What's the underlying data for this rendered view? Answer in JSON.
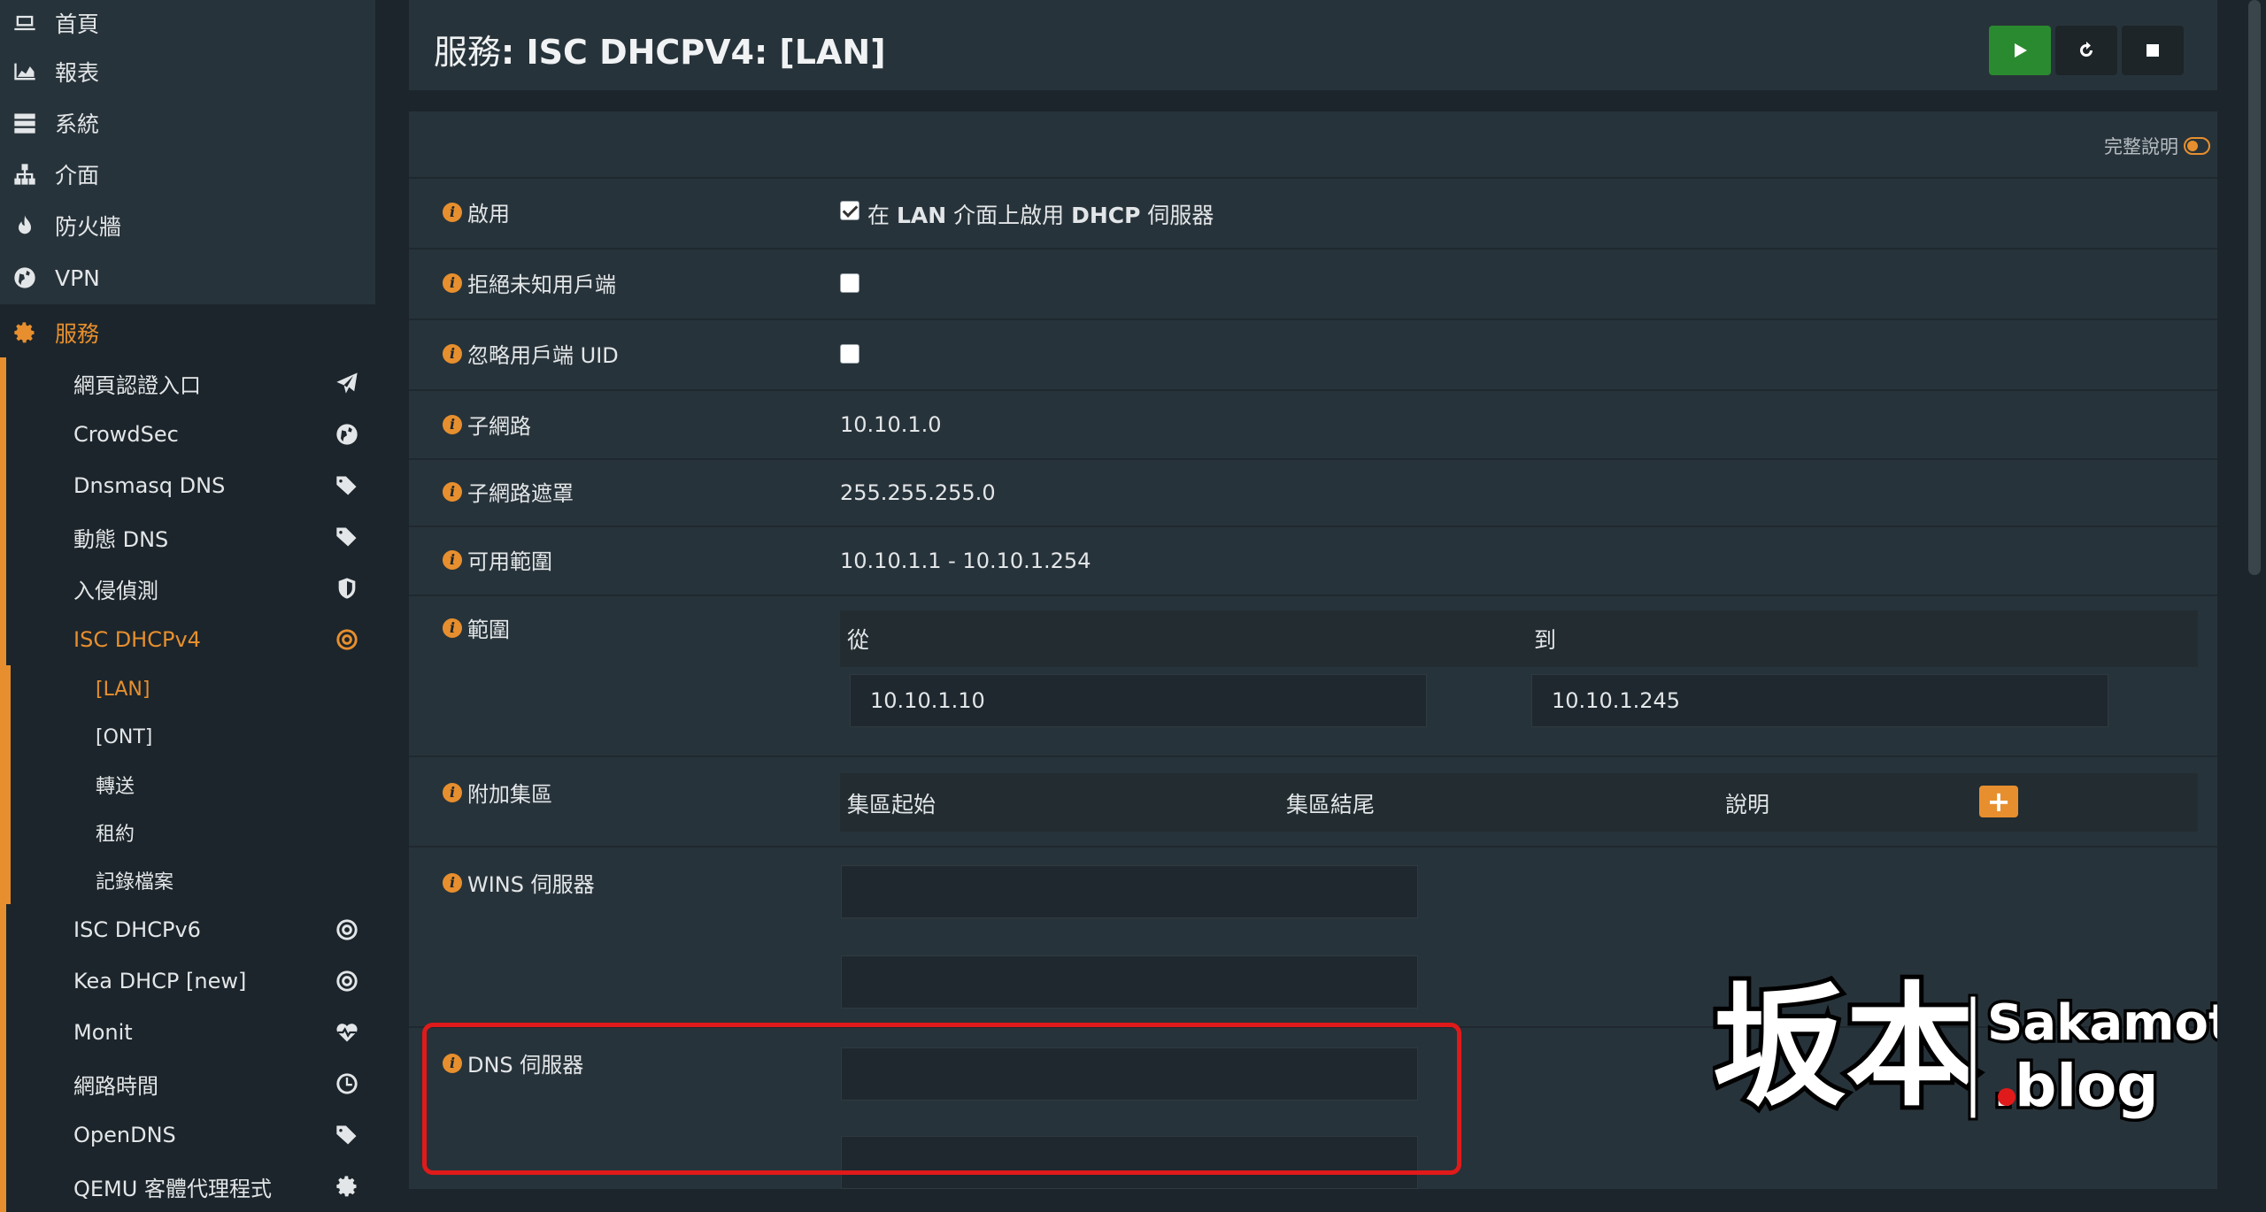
{
  "sidebar": {
    "top_items": [
      {
        "label": "首頁",
        "icon": "laptop-icon"
      },
      {
        "label": "報表",
        "icon": "area-chart-icon"
      },
      {
        "label": "系統",
        "icon": "server-icon"
      },
      {
        "label": "介面",
        "icon": "sitemap-icon"
      },
      {
        "label": "防火牆",
        "icon": "fire-icon"
      },
      {
        "label": "VPN",
        "icon": "globe-icon"
      }
    ],
    "services": {
      "label": "服務",
      "icon": "gear-icon"
    },
    "service_items": [
      {
        "label": "網頁認證入口",
        "icon": "paper-plane-icon"
      },
      {
        "label": "CrowdSec",
        "icon": "globe-icon"
      },
      {
        "label": "Dnsmasq DNS",
        "icon": "tags-icon"
      },
      {
        "label": "動態 DNS",
        "icon": "tags-icon"
      },
      {
        "label": "入侵偵測",
        "icon": "shield-icon"
      },
      {
        "label": "ISC DHCPv4",
        "icon": "bullseye-icon"
      }
    ],
    "dhcp_items": [
      "[LAN]",
      "[ONT]",
      "轉送",
      "租約",
      "記錄檔案"
    ],
    "more_items": [
      {
        "label": "ISC DHCPv6",
        "icon": "bullseye-icon"
      },
      {
        "label": "Kea DHCP [new]",
        "icon": "bullseye-icon"
      },
      {
        "label": "Monit",
        "icon": "heartbeat-icon"
      },
      {
        "label": "網路時間",
        "icon": "clock-icon"
      },
      {
        "label": "OpenDNS",
        "icon": "tags-icon"
      },
      {
        "label": "QEMU 客體代理程式",
        "icon": "gear-icon"
      }
    ]
  },
  "header": {
    "title_prefix": "服務",
    "title_main": ": ISC DHCPV4: [LAN]"
  },
  "content": {
    "help_label": "完整說明",
    "rows": {
      "enable": {
        "label": "啟用",
        "checked": true,
        "text_pre": "在 ",
        "text_b1": "LAN",
        " text_mid": "",
        "text_mid": " 介面上啟用 ",
        "text_b2": "DHCP",
        "text_post": " 伺服器"
      },
      "deny_unknown": {
        "label": "拒絕未知用戶端",
        "checked": false
      },
      "ignore_uid": {
        "label": "忽略用戶端 UID",
        "checked": false
      },
      "subnet": {
        "label": "子網路",
        "value": "10.10.1.0"
      },
      "subnet_mask": {
        "label": "子網路遮罩",
        "value": "255.255.255.0"
      },
      "available_range": {
        "label": "可用範圍",
        "value": "10.10.1.1 - 10.10.1.254"
      },
      "range": {
        "label": "範圍",
        "from_header": "從",
        "to_header": "到",
        "from_value": "10.10.1.10",
        "to_value": "10.10.1.245"
      },
      "additional_pools": {
        "label": "附加集區",
        "col_start": "集區起始",
        "col_end": "集區結尾",
        "col_desc": "說明",
        "add_symbol": "+"
      },
      "wins": {
        "label": "WINS 伺服器"
      },
      "dns": {
        "label": "DNS 伺服器"
      }
    }
  },
  "watermark": {
    "brand": "坂本",
    "site": "Sakamoto",
    "tld": ".blog"
  },
  "colors": {
    "accent": "#e78f2e",
    "start_green": "#2a8a2f",
    "highlight_red": "#e01a1a"
  }
}
